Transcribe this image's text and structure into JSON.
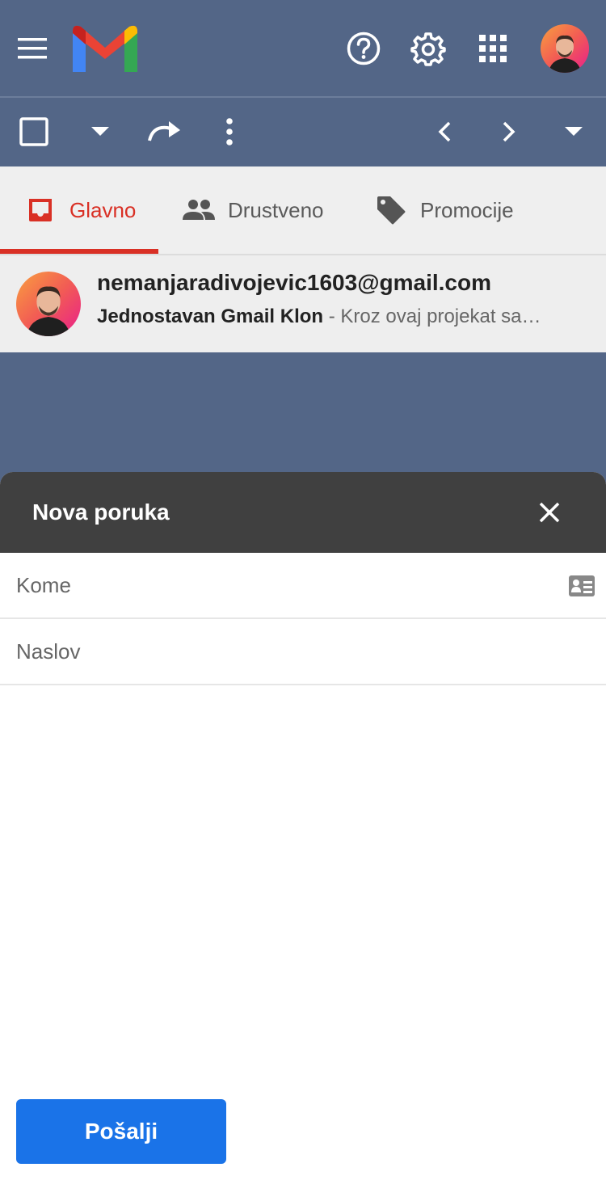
{
  "header": {
    "icons": {
      "menu": "hamburger-menu-icon",
      "logo": "gmail-logo",
      "help": "help-circle-icon",
      "settings": "gear-icon",
      "apps": "apps-grid-icon",
      "account": "account-avatar"
    }
  },
  "toolbar": {
    "icons": [
      "checkbox-icon",
      "caret-down-icon",
      "refresh-icon",
      "more-vert-icon",
      "chevron-left-icon",
      "chevron-right-icon",
      "caret-down-icon"
    ]
  },
  "tabs": [
    {
      "label": "Glavno",
      "icon": "inbox-icon",
      "active": true
    },
    {
      "label": "Drustveno",
      "icon": "people-icon",
      "active": false
    },
    {
      "label": "Promocije",
      "icon": "tag-icon",
      "active": false
    }
  ],
  "email": {
    "from": "nemanjaradivojevic1603@gmail.com",
    "subject": "Jednostavan Gmail Klon",
    "snippet": " - Kroz ovaj projekat sa…"
  },
  "compose": {
    "title": "Nova poruka",
    "to_placeholder": "Kome",
    "subject_placeholder": "Naslov",
    "send_label": "Pošalji"
  },
  "colors": {
    "background": "#536687",
    "active_tab": "#d93025",
    "compose_header": "#404040",
    "send_button": "#1a73e8"
  }
}
